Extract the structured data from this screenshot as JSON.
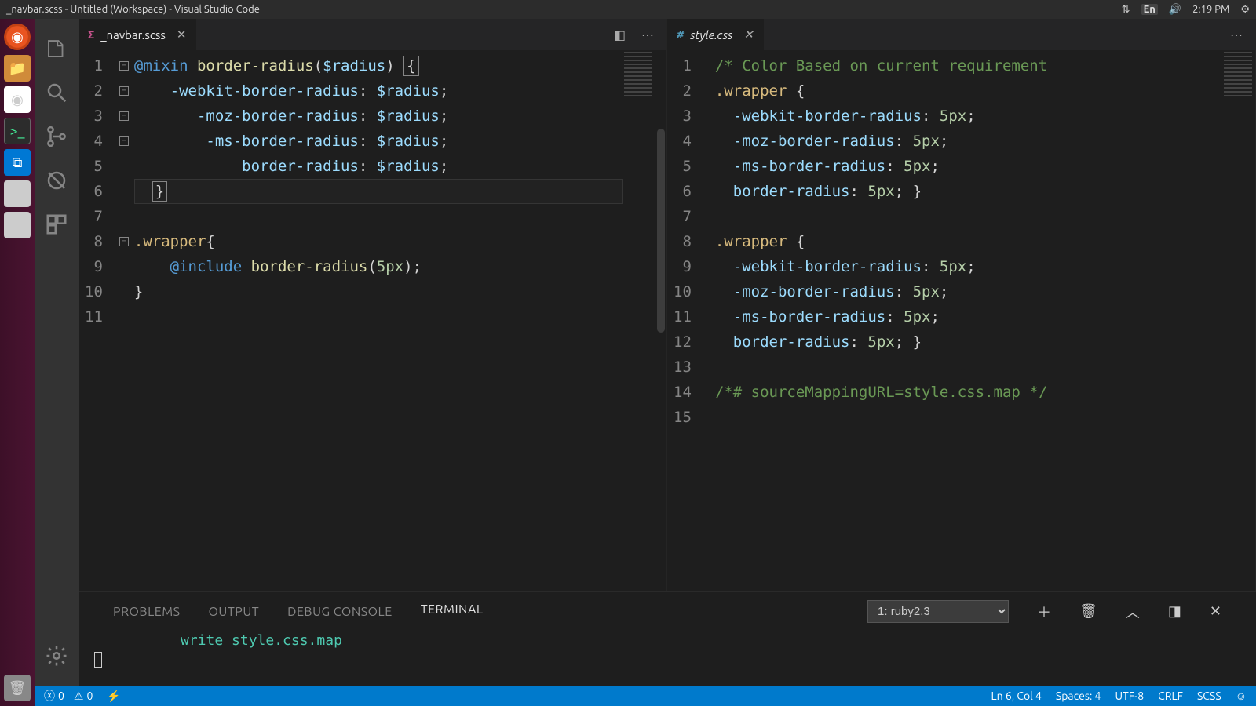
{
  "ubuntu_top": {
    "title": "_navbar.scss - Untitled (Workspace) - Visual Studio Code",
    "lang": "En",
    "time": "2:19 PM"
  },
  "tabs": {
    "left": {
      "name": "_navbar.scss"
    },
    "right": {
      "name": "style.css"
    }
  },
  "editor_left": {
    "lines": [
      {
        "n": 1,
        "fold": true,
        "html": "<span class='kw'>@mixin</span> <span class='fn'>border-radius</span>(<span class='var'>$radius</span>) <span class='boxbr'>{</span>"
      },
      {
        "n": 2,
        "fold": true,
        "html": "    <span class='prop'>-webkit-border-radius</span>: <span class='val'>$radius</span>;"
      },
      {
        "n": 3,
        "fold": true,
        "html": "       <span class='prop'>-moz-border-radius</span>: <span class='val'>$radius</span>;"
      },
      {
        "n": 4,
        "fold": true,
        "html": "        <span class='prop'>-ms-border-radius</span>: <span class='val'>$radius</span>;"
      },
      {
        "n": 5,
        "fold": false,
        "html": "            <span class='prop'>border-radius</span>: <span class='val'>$radius</span>;"
      },
      {
        "n": 6,
        "fold": false,
        "html": "  <span class='boxbr'>}</span>",
        "cursor": true
      },
      {
        "n": 7,
        "fold": false,
        "html": ""
      },
      {
        "n": 8,
        "fold": true,
        "html": "<span class='sel'>.wrapper</span>{"
      },
      {
        "n": 9,
        "fold": false,
        "html": "    <span class='kw'>@include</span> <span class='fn'>border-radius</span>(<span class='num'>5px</span>);"
      },
      {
        "n": 10,
        "fold": false,
        "html": "}"
      },
      {
        "n": 11,
        "fold": false,
        "html": ""
      }
    ]
  },
  "editor_right": {
    "lines": [
      {
        "n": 1,
        "html": "<span class='cmt'>/* Color Based on current requirement</span>"
      },
      {
        "n": 2,
        "html": "<span class='sel'>.wrapper</span> {"
      },
      {
        "n": 3,
        "html": "  <span class='prop'>-webkit-border-radius</span>: <span class='num'>5px</span>;"
      },
      {
        "n": 4,
        "html": "  <span class='prop'>-moz-border-radius</span>: <span class='num'>5px</span>;"
      },
      {
        "n": 5,
        "html": "  <span class='prop'>-ms-border-radius</span>: <span class='num'>5px</span>;"
      },
      {
        "n": 6,
        "html": "  <span class='prop'>border-radius</span>: <span class='num'>5px</span>; }"
      },
      {
        "n": 7,
        "html": ""
      },
      {
        "n": 8,
        "html": "<span class='sel'>.wrapper</span> {"
      },
      {
        "n": 9,
        "html": "  <span class='prop'>-webkit-border-radius</span>: <span class='num'>5px</span>;"
      },
      {
        "n": 10,
        "html": "  <span class='prop'>-moz-border-radius</span>: <span class='num'>5px</span>;"
      },
      {
        "n": 11,
        "html": "  <span class='prop'>-ms-border-radius</span>: <span class='num'>5px</span>;"
      },
      {
        "n": 12,
        "html": "  <span class='prop'>border-radius</span>: <span class='num'>5px</span>; }"
      },
      {
        "n": 13,
        "html": ""
      },
      {
        "n": 14,
        "html": "<span class='cmt'>/*# sourceMappingURL=style.css.map */</span>"
      },
      {
        "n": 15,
        "html": ""
      }
    ]
  },
  "panel": {
    "tabs": [
      "PROBLEMS",
      "OUTPUT",
      "DEBUG CONSOLE",
      "TERMINAL"
    ],
    "active": "TERMINAL",
    "dropdown": "1: ruby2.3",
    "terminal_line": "write style.css.map"
  },
  "status": {
    "errors": "0",
    "warnings": "0",
    "cursor": "Ln 6, Col 4",
    "spaces": "Spaces: 4",
    "encoding": "UTF-8",
    "eol": "CRLF",
    "lang": "SCSS"
  }
}
